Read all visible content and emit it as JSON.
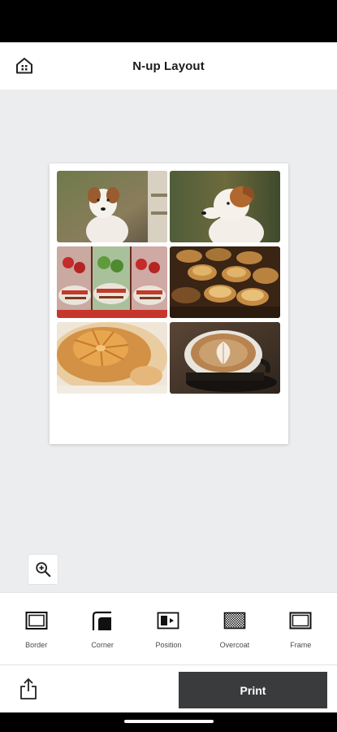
{
  "header": {
    "title": "N-up Layout",
    "home_icon": "home-icon"
  },
  "layout": {
    "photos": [
      {
        "subject": "dog-portrait-left"
      },
      {
        "subject": "dog-portrait-right"
      },
      {
        "subject": "snack-bags"
      },
      {
        "subject": "baked-tarts"
      },
      {
        "subject": "fruit-pie"
      },
      {
        "subject": "latte-art-coffee"
      }
    ]
  },
  "zoom": {
    "icon": "zoom-in-icon"
  },
  "toolbar": {
    "items": [
      {
        "label": "Border",
        "icon": "border-icon"
      },
      {
        "label": "Corner",
        "icon": "corner-icon"
      },
      {
        "label": "Position",
        "icon": "position-icon"
      },
      {
        "label": "Overcoat",
        "icon": "overcoat-icon"
      },
      {
        "label": "Frame",
        "icon": "frame-icon"
      }
    ]
  },
  "bottom": {
    "share_icon": "share-icon",
    "print_label": "Print"
  },
  "colors": {
    "accent": "#3a3b3d",
    "canvas": "#ecedef"
  }
}
